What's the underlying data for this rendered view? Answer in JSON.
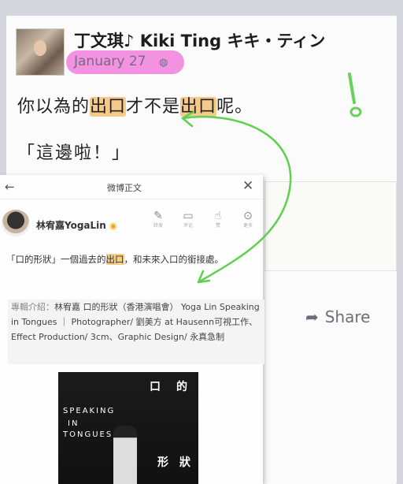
{
  "facebook": {
    "name": "丁文琪♪ Kiki Ting キキ・ティン",
    "date": "January 27",
    "privacy_icon": "globe-icon",
    "post": {
      "part1": "你以為的",
      "hl1": "出口",
      "part2": "才不是",
      "hl2": "出口",
      "part3": "呢。",
      "line2": "「這邊啦！」"
    },
    "share_label": "Share",
    "colors": {
      "date_highlight": "#ef6fd8",
      "text_highlight": "#f5c98a",
      "arrow": "#5fcf4e"
    }
  },
  "weibo": {
    "title": "微博正文",
    "username": "林宥嘉YogaLin",
    "actions": [
      {
        "icon": "edit-icon",
        "label": "转发"
      },
      {
        "icon": "comment-icon",
        "label": "评论"
      },
      {
        "icon": "like-icon",
        "label": "赞"
      },
      {
        "icon": "more-icon",
        "label": "更多"
      }
    ],
    "text": {
      "before": "「口的形狀」一個過去的",
      "hl": "出口",
      "after": "，和未來入口的銜接處。"
    },
    "caption": {
      "lead": "專輯介紹：",
      "body": "林宥嘉 口的形狀（香港演唱會） Yoga Lin Speaking in Tongues ｜ Photographer/ 劉美方 at Hausenn可視工作、Effect Production/ 3cm、Graphic Design/ 永真急制"
    },
    "album": {
      "title_a": "口",
      "title_b": "的",
      "title_c": "形",
      "title_d": "狀",
      "en_a": "SPEAKING",
      "en_b": "IN",
      "en_c": "TONGUES"
    }
  }
}
